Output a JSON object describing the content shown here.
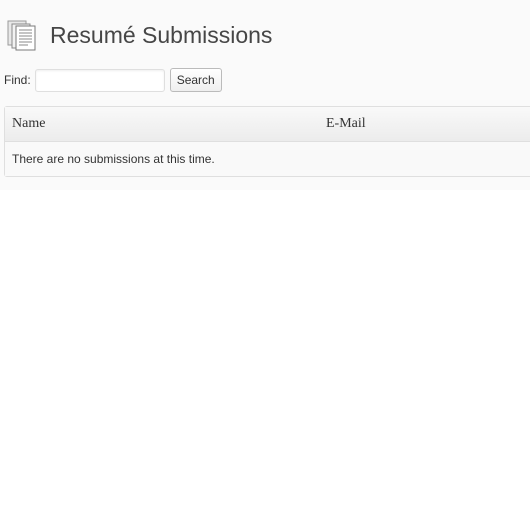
{
  "header": {
    "icon": "document-pages-icon",
    "title": "Resumé Submissions"
  },
  "search": {
    "label": "Find:",
    "value": "",
    "placeholder": "",
    "button_label": "Search"
  },
  "table": {
    "columns": [
      "Name",
      "E-Mail"
    ],
    "empty_message": "There are no submissions at this time."
  }
}
